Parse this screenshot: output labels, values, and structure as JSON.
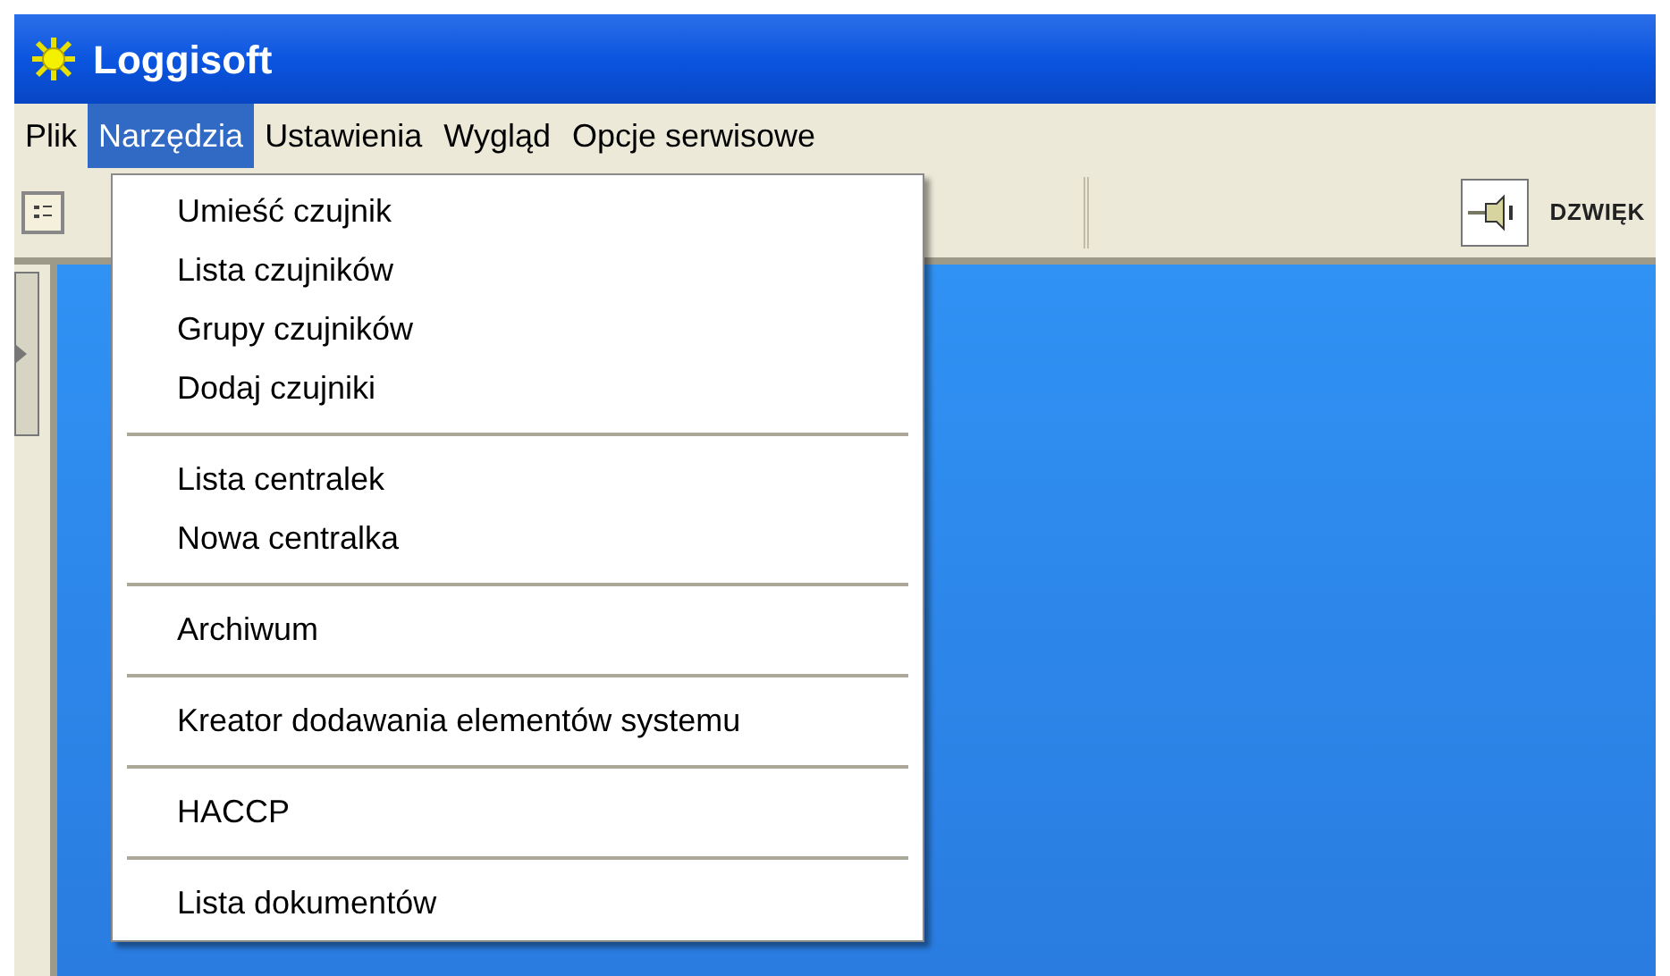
{
  "window": {
    "title": "Loggisoft"
  },
  "menu_bar": [
    {
      "label": "Plik",
      "selected": false
    },
    {
      "label": "Narzędzia",
      "selected": true
    },
    {
      "label": "Ustawienia",
      "selected": false
    },
    {
      "label": "Wygląd",
      "selected": false
    },
    {
      "label": "Opcje serwisowe",
      "selected": false
    }
  ],
  "dropdown": {
    "groups": [
      [
        "Umieść czujnik",
        "Lista czujników",
        "Grupy czujników",
        "Dodaj czujniki"
      ],
      [
        "Lista centralek",
        "Nowa centralka"
      ],
      [
        "Archiwum"
      ],
      [
        "Kreator dodawania elementów systemu"
      ],
      [
        "HACCP"
      ],
      [
        "Lista dokumentów"
      ]
    ]
  },
  "toolbar": {
    "sound_label": "DZWIĘK"
  }
}
